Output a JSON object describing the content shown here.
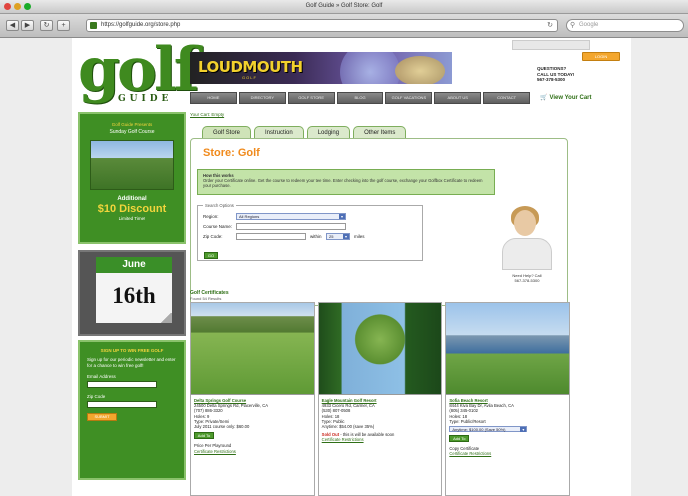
{
  "window": {
    "title": "Golf Guide » Golf Store: Golf",
    "url": "https://golfguide.org/store.php",
    "search_placeholder": "Google"
  },
  "colors": {
    "brand_green": "#3f8f24",
    "accent_orange": "#f08a1c",
    "link_green": "#2f6f16"
  },
  "header": {
    "logo_word": "golf",
    "logo_sub": "GUIDE",
    "banner_brand": "LOUDMOUTH",
    "banner_sub": "GOLF",
    "orange_button": "LOGIN",
    "contact_lines": [
      "QUESTIONS?",
      "CALL US TODAY!",
      "567-378-5300"
    ],
    "cart_label": "View Your Cart",
    "nav": [
      "HOME",
      "DIRECTORY",
      "GOLF STORE",
      "BLOG",
      "GOLF VACATIONS",
      "ABOUT US",
      "CONTACT"
    ]
  },
  "sidebar": {
    "promo": {
      "top": "Golf Guide Presents",
      "course": "Sunday Golf Course",
      "additional": "Additional",
      "discount": "$10 Discount",
      "note": "Limited Time!"
    },
    "calendar": {
      "month": "June",
      "day": "16th"
    },
    "signup": {
      "heading": "SIGN UP TO WIN FREE GOLF",
      "body": "Sign up for our periodic newsletter and enter for a chance to win free golf!",
      "email_label": "Email Address",
      "zip_label": "Zip Code",
      "button": "SUBMIT"
    }
  },
  "main": {
    "breadcrumb": "Your Cart: Empty",
    "tabs": [
      "Golf Store",
      "Instruction",
      "Lodging",
      "Other Items"
    ],
    "store_title": "Store: Golf",
    "info_heading": "How this works",
    "info_body": "Order your Certificate online. Get the course to redeem your tee time. Enter checking into the golf course, exchange your Golfbox Certificate to redeem your purchase.",
    "search": {
      "legend": "Search Options",
      "region_label": "Region:",
      "region_value": "All Regions",
      "course_label": "Course Name:",
      "zip_label": "Zip Code:",
      "within_label": "within",
      "distance_value": "25",
      "miles_label": "miles",
      "go_button": "GO"
    },
    "agent_caption": [
      "Need Help? Call",
      "567-378-5300"
    ],
    "results_title": "Golf Certificates",
    "results_sub": "Found 54 Results",
    "cards": [
      {
        "name": "Delta Springs Golf Course",
        "address": "24500 Delta Springs Rd, Placerville, CA",
        "phone": "(707) 886-3320",
        "holes": "Holes: 9",
        "type": "Type: Private/Semi",
        "price": "July 2011 course only: $60.00",
        "button": "Add To Cart",
        "note": "Price Per Playround",
        "link": "Certificate Restrictions"
      },
      {
        "name": "Eagle Mountain Golf Resort",
        "address": "4933 Cicero Rd, Carmel, CA",
        "phone": "(530) 807-0508",
        "holes": "Holes: 18",
        "type": "Type: Public",
        "price": "Anytime: $54.00 (save 35%)",
        "button": "Sold Out",
        "note": "- this is will be available soon",
        "link": "Certificate Restrictions"
      },
      {
        "name": "Sofia Beach Resort",
        "address": "8444 Kiva Bay Dr, Avila Beach, CA",
        "phone": "(805) 345-0102",
        "holes": "Holes: 18",
        "type": "Type: Public/Resort",
        "price": "Anytime: $100.00 (Save 50%)",
        "button": "Add To Cart",
        "note": "Copy Certificate",
        "link": "Certificate Restrictions"
      }
    ]
  }
}
